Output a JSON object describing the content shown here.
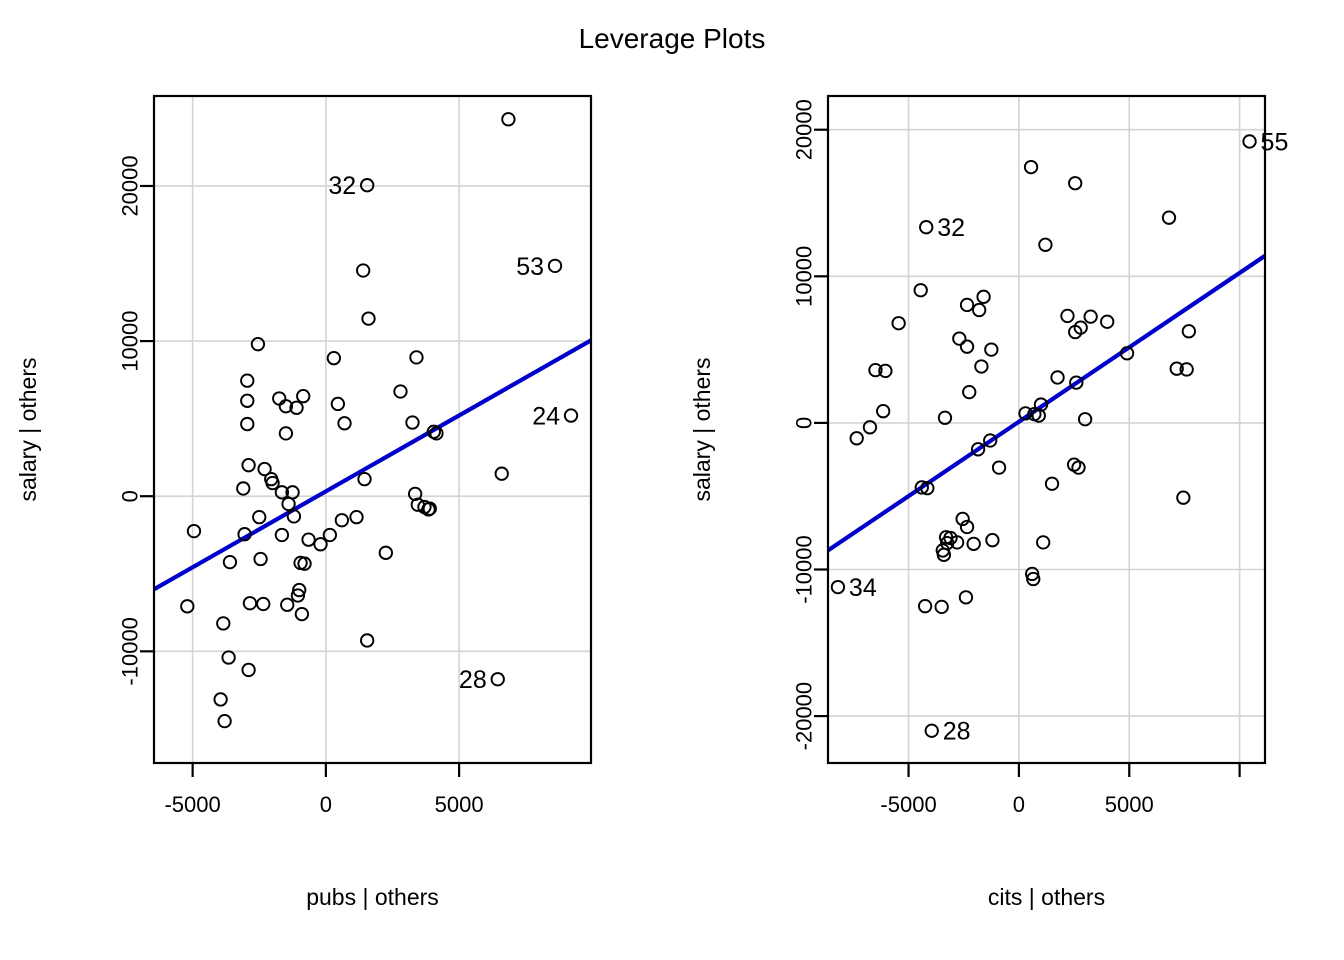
{
  "chart_data": [
    {
      "type": "scatter",
      "title": "Leverage Plots",
      "panel": "left",
      "xlabel": "pubs | others",
      "ylabel": "salary | others",
      "xlim": [
        -6450,
        9950
      ],
      "ylim": [
        -17200,
        25800
      ],
      "xticks": [
        -5000,
        0,
        5000
      ],
      "xtick_labels": [
        "-5000",
        "0",
        "5000"
      ],
      "yticks": [
        20000,
        10000,
        0,
        -10000
      ],
      "ytick_labels": [
        "20000",
        "10000",
        "0",
        "-10000"
      ],
      "grid": true,
      "legend": "none",
      "line_color": "#0000CC",
      "line_endpoints": [
        [
          -6450,
          -6000
        ],
        [
          9950,
          10050
        ]
      ],
      "point_labels": [
        {
          "id": "32",
          "x": 1550,
          "y": 20050,
          "side": "left"
        },
        {
          "id": "53",
          "x": 8600,
          "y": 14850,
          "side": "left"
        },
        {
          "id": "24",
          "x": 9200,
          "y": 5200,
          "side": "left"
        },
        {
          "id": "28",
          "x": 6450,
          "y": -11800,
          "side": "left"
        }
      ],
      "points": [
        [
          6850,
          24300
        ],
        [
          1550,
          20050
        ],
        [
          8600,
          14850
        ],
        [
          1400,
          14550
        ],
        [
          1600,
          11450
        ],
        [
          -2550,
          9800
        ],
        [
          300,
          8900
        ],
        [
          3400,
          8950
        ],
        [
          -2950,
          7450
        ],
        [
          2800,
          6750
        ],
        [
          -2950,
          6150
        ],
        [
          -1750,
          6300
        ],
        [
          -850,
          6450
        ],
        [
          -1500,
          5800
        ],
        [
          -1100,
          5700
        ],
        [
          450,
          5950
        ],
        [
          9200,
          5200
        ],
        [
          700,
          4700
        ],
        [
          3250,
          4750
        ],
        [
          -2950,
          4650
        ],
        [
          -1500,
          4050
        ],
        [
          -2900,
          2000
        ],
        [
          -2300,
          1750
        ],
        [
          -2050,
          1100
        ],
        [
          -2000,
          850
        ],
        [
          -3100,
          500
        ],
        [
          1450,
          1100
        ],
        [
          -1650,
          250
        ],
        [
          -1250,
          250
        ],
        [
          -1400,
          -500
        ],
        [
          4150,
          4050
        ],
        [
          4050,
          4150
        ],
        [
          6600,
          1450
        ],
        [
          3350,
          150
        ],
        [
          3450,
          -550
        ],
        [
          3700,
          -700
        ],
        [
          3900,
          -800
        ],
        [
          3850,
          -850
        ],
        [
          -2500,
          -1350
        ],
        [
          -1200,
          -1300
        ],
        [
          600,
          -1550
        ],
        [
          1150,
          -1350
        ],
        [
          -4950,
          -2250
        ],
        [
          -3050,
          -2450
        ],
        [
          -1650,
          -2500
        ],
        [
          -650,
          -2800
        ],
        [
          150,
          -2500
        ],
        [
          -200,
          -3100
        ],
        [
          2250,
          -3650
        ],
        [
          -2450,
          -4050
        ],
        [
          -3600,
          -4250
        ],
        [
          -950,
          -4300
        ],
        [
          -800,
          -4350
        ],
        [
          -5200,
          -7100
        ],
        [
          -3850,
          -8200
        ],
        [
          -2850,
          -6900
        ],
        [
          -2350,
          -6950
        ],
        [
          -1450,
          -7000
        ],
        [
          -1000,
          -6050
        ],
        [
          -1050,
          -6400
        ],
        [
          -900,
          -7600
        ],
        [
          6450,
          -11800
        ],
        [
          1550,
          -9300
        ],
        [
          -3650,
          -10400
        ],
        [
          -2900,
          -11200
        ],
        [
          -3950,
          -13100
        ],
        [
          -3800,
          -14500
        ]
      ]
    },
    {
      "type": "scatter",
      "title": "Leverage Plots",
      "panel": "right",
      "xlabel": "cits | others",
      "ylabel": "salary | others",
      "xlim": [
        -8650,
        11150
      ],
      "ylim": [
        -23200,
        22300
      ],
      "xticks": [
        -5000,
        0,
        5000,
        10000
      ],
      "xtick_labels": [
        "-5000",
        "0",
        "5000",
        ""
      ],
      "yticks": [
        20000,
        10000,
        0,
        -10000,
        -20000
      ],
      "ytick_labels": [
        "20000",
        "10000",
        "0",
        "-10000",
        "-20000"
      ],
      "grid": true,
      "legend": "none",
      "line_color": "#0000CC",
      "line_endpoints": [
        [
          -8650,
          -8700
        ],
        [
          11150,
          11400
        ]
      ],
      "point_labels": [
        {
          "id": "55",
          "x": 10450,
          "y": 19200,
          "side": "right"
        },
        {
          "id": "32",
          "x": -4200,
          "y": 13350,
          "side": "right"
        },
        {
          "id": "34",
          "x": -8200,
          "y": -11200,
          "side": "right"
        },
        {
          "id": "28",
          "x": -3950,
          "y": -21000,
          "side": "right"
        }
      ],
      "points": [
        [
          10450,
          19200
        ],
        [
          550,
          17450
        ],
        [
          2550,
          16350
        ],
        [
          6800,
          14000
        ],
        [
          -4200,
          13350
        ],
        [
          1200,
          12150
        ],
        [
          -4450,
          9050
        ],
        [
          -1600,
          8600
        ],
        [
          -2350,
          8050
        ],
        [
          -1800,
          7700
        ],
        [
          2200,
          7300
        ],
        [
          3250,
          7250
        ],
        [
          4000,
          6900
        ],
        [
          2800,
          6500
        ],
        [
          2550,
          6200
        ],
        [
          7700,
          6250
        ],
        [
          -5450,
          6800
        ],
        [
          -2700,
          5750
        ],
        [
          -2350,
          5200
        ],
        [
          -1250,
          5000
        ],
        [
          4900,
          4750
        ],
        [
          -1700,
          3850
        ],
        [
          7150,
          3700
        ],
        [
          7600,
          3650
        ],
        [
          -6500,
          3600
        ],
        [
          -6050,
          3550
        ],
        [
          1750,
          3100
        ],
        [
          2600,
          2750
        ],
        [
          -2250,
          2100
        ],
        [
          1000,
          1250
        ],
        [
          300,
          650
        ],
        [
          -3350,
          350
        ],
        [
          3000,
          250
        ],
        [
          -6150,
          800
        ],
        [
          700,
          600
        ],
        [
          900,
          500
        ],
        [
          -6750,
          -300
        ],
        [
          -7350,
          -1050
        ],
        [
          -4400,
          -4400
        ],
        [
          -4150,
          -4450
        ],
        [
          -1300,
          -1200
        ],
        [
          -1850,
          -1800
        ],
        [
          -900,
          -3050
        ],
        [
          2500,
          -2850
        ],
        [
          2700,
          -3050
        ],
        [
          1500,
          -4150
        ],
        [
          -2550,
          -6550
        ],
        [
          -2350,
          -7100
        ],
        [
          -3300,
          -7800
        ],
        [
          -3100,
          -7850
        ],
        [
          -2800,
          -8150
        ],
        [
          -2050,
          -8250
        ],
        [
          -3450,
          -8700
        ],
        [
          -3400,
          -9000
        ],
        [
          -3250,
          -8200
        ],
        [
          1100,
          -8150
        ],
        [
          -1200,
          -8000
        ],
        [
          7450,
          -5100
        ],
        [
          600,
          -10300
        ],
        [
          650,
          -10650
        ],
        [
          -8200,
          -11200
        ],
        [
          -4250,
          -12500
        ],
        [
          -3500,
          -12550
        ],
        [
          -2400,
          -11900
        ],
        [
          -3950,
          -21000
        ]
      ]
    }
  ],
  "title": "Leverage Plots",
  "left_panel": {
    "x_axis_title": "pubs | others",
    "y_axis_title": "salary | others",
    "x_tick_labels": [
      "-5000",
      "0",
      "5000"
    ],
    "y_tick_labels": [
      "20000",
      "10000",
      "0",
      "-10000"
    ],
    "labels": [
      "32",
      "53",
      "24",
      "28"
    ]
  },
  "right_panel": {
    "x_axis_title": "cits | others",
    "y_axis_title": "salary | others",
    "x_tick_labels": [
      "-5000",
      "0",
      "5000"
    ],
    "y_tick_labels": [
      "20000",
      "10000",
      "0",
      "-10000",
      "-20000"
    ],
    "labels": [
      "55",
      "32",
      "34",
      "28"
    ]
  },
  "colors": {
    "regression_line": "#0000CC",
    "grid": "#d4d4d4",
    "axis": "#000000",
    "point": "#000000",
    "background": "#ffffff"
  }
}
